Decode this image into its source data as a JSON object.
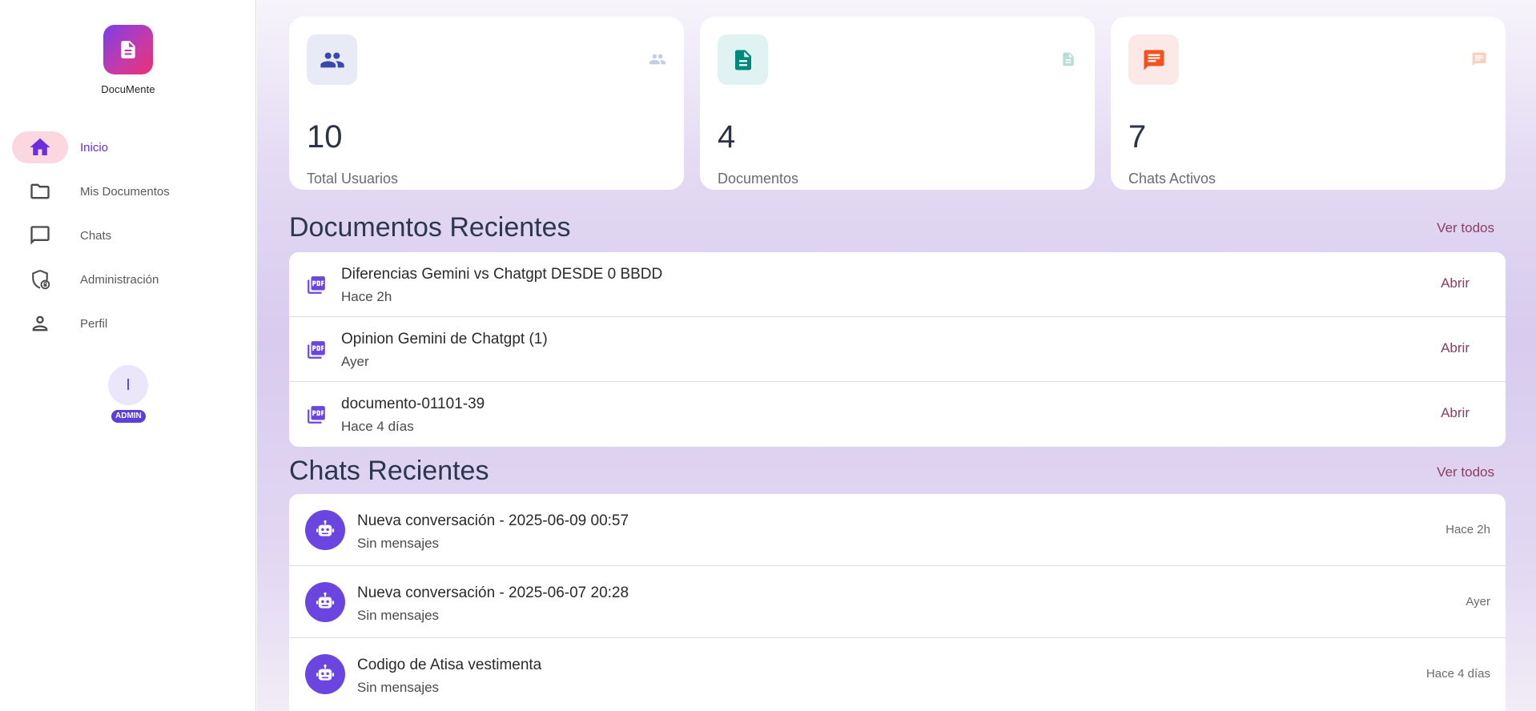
{
  "app": {
    "name": "DocuMente"
  },
  "sidebar": {
    "items": [
      {
        "label": "Inicio",
        "icon": "home-icon",
        "active": true
      },
      {
        "label": "Mis Documentos",
        "icon": "folder-icon",
        "active": false
      },
      {
        "label": "Chats",
        "icon": "chat-bubble-icon",
        "active": false
      },
      {
        "label": "Administración",
        "icon": "admin-shield-icon",
        "active": false
      },
      {
        "label": "Perfil",
        "icon": "person-icon",
        "active": false
      }
    ],
    "user": {
      "initial": "I",
      "role": "ADMIN"
    }
  },
  "stats": [
    {
      "value": "10",
      "label": "Total Usuarios",
      "icon": "people-icon",
      "color": "#3949ab",
      "bg": "#e8eaf6"
    },
    {
      "value": "4",
      "label": "Documentos",
      "icon": "document-icon",
      "color": "#00897b",
      "bg": "#e0f2f1"
    },
    {
      "value": "7",
      "label": "Chats Activos",
      "icon": "chat-icon",
      "color": "#f4511e",
      "bg": "#fbe9e7"
    }
  ],
  "documents": {
    "title": "Documentos Recientes",
    "see_all": "Ver todos",
    "open_label": "Abrir",
    "items": [
      {
        "name": "Diferencias Gemini vs Chatgpt DESDE 0 BBDD",
        "time": "Hace 2h"
      },
      {
        "name": "Opinion Gemini de Chatgpt (1)",
        "time": "Ayer"
      },
      {
        "name": "documento-01101-39",
        "time": "Hace 4 días"
      }
    ]
  },
  "chats": {
    "title": "Chats Recientes",
    "see_all": "Ver todos",
    "items": [
      {
        "title": "Nueva conversación - 2025-06-09 00:57",
        "subtitle": "Sin mensajes",
        "time": "Hace 2h"
      },
      {
        "title": "Nueva conversación - 2025-06-07 20:28",
        "subtitle": "Sin mensajes",
        "time": "Ayer"
      },
      {
        "title": "Codigo de Atisa vestimenta",
        "subtitle": "Sin mensajes",
        "time": "Hace 4 días"
      }
    ]
  },
  "colors": {
    "accent": "#6c2fe0",
    "link": "#8a3f62",
    "active_pill": "#fbd7e0",
    "badge": "#5b3fd6"
  }
}
